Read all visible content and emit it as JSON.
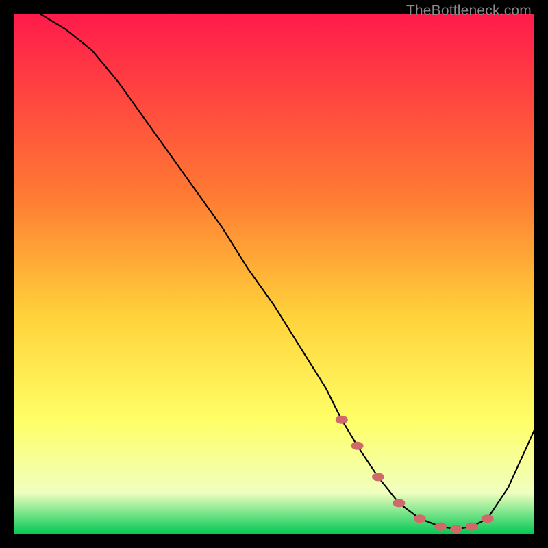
{
  "watermark": "TheBottleneck.com",
  "gradient": {
    "top": "#ff1a4b",
    "mid1": "#ff7a33",
    "mid2": "#ffd23a",
    "mid3": "#ffff66",
    "low": "#f0ffbf",
    "bottom": "#00c853"
  },
  "marker_color": "#d06a6a",
  "curve_color": "#000000",
  "chart_data": {
    "type": "line",
    "title": "",
    "xlabel": "",
    "ylabel": "",
    "xlim": [
      0,
      100
    ],
    "ylim": [
      0,
      100
    ],
    "series": [
      {
        "name": "bottleneck-curve",
        "x": [
          5,
          10,
          15,
          20,
          25,
          30,
          35,
          40,
          45,
          50,
          55,
          60,
          63,
          66,
          70,
          74,
          78,
          82,
          85,
          88,
          91,
          95,
          100
        ],
        "values": [
          100,
          97,
          93,
          87,
          80,
          73,
          66,
          59,
          51,
          44,
          36,
          28,
          22,
          17,
          11,
          6,
          3,
          1.5,
          1,
          1.5,
          3,
          9,
          20
        ]
      }
    ],
    "markers": {
      "name": "highlight-points",
      "x": [
        63,
        66,
        70,
        74,
        78,
        82,
        85,
        88,
        91
      ],
      "values": [
        22,
        17,
        11,
        6,
        3,
        1.5,
        1,
        1.5,
        3
      ]
    }
  }
}
